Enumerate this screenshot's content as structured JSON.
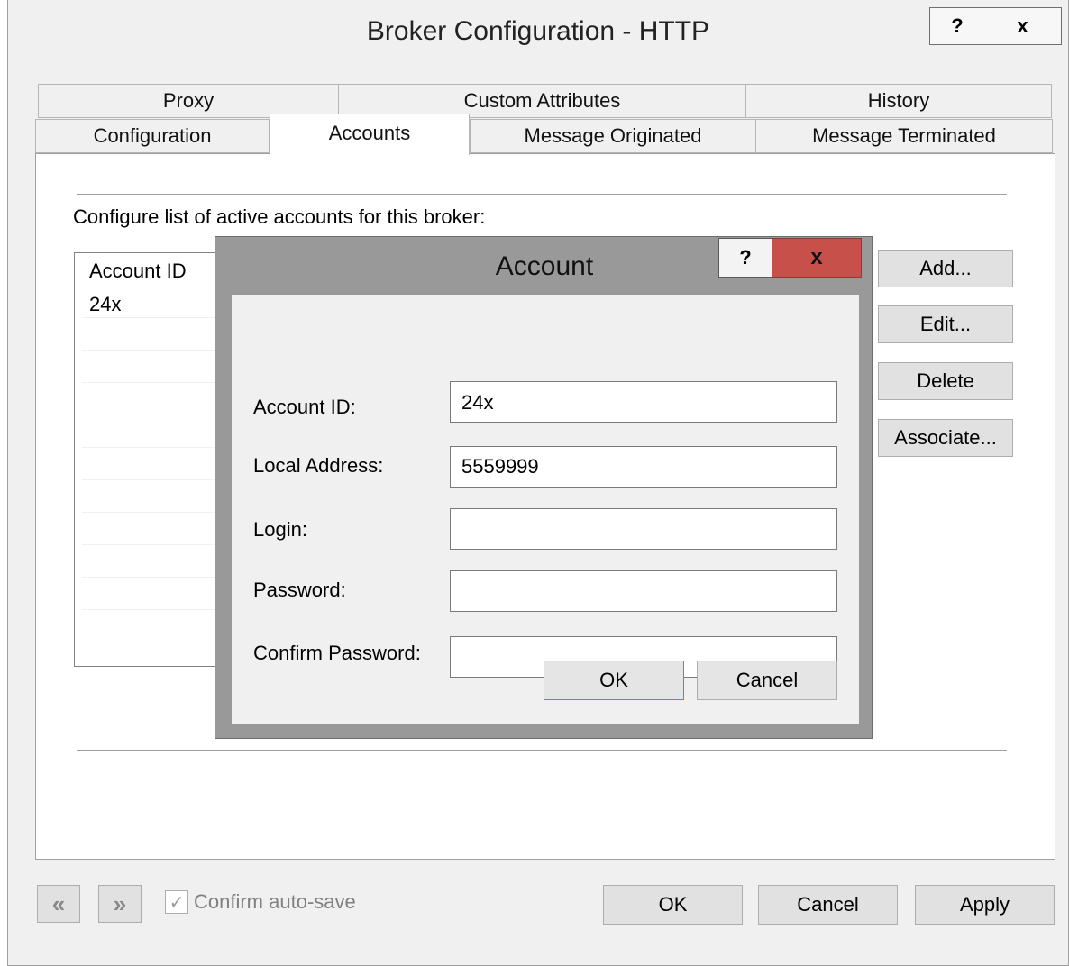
{
  "window": {
    "title": "Broker Configuration - HTTP",
    "help_label": "?",
    "close_label": "x"
  },
  "tabs": {
    "row1": [
      "Proxy",
      "Custom Attributes",
      "History"
    ],
    "row2": [
      "Configuration",
      "Accounts",
      "Message Originated",
      "Message Terminated"
    ],
    "active": "Accounts"
  },
  "accounts": {
    "description": "Configure list of active accounts for this broker:",
    "column_header": "Account ID",
    "rows": [
      "24x"
    ],
    "buttons": {
      "add": "Add...",
      "edit": "Edit...",
      "delete": "Delete",
      "associate": "Associate..."
    }
  },
  "footer": {
    "prev_icon": "«",
    "next_icon": "»",
    "confirm_checked": true,
    "confirm_label": "Confirm auto-save",
    "ok": "OK",
    "cancel": "Cancel",
    "apply": "Apply"
  },
  "dialog": {
    "title": "Account",
    "help_label": "?",
    "close_label": "x",
    "fields": {
      "account_id": {
        "label": "Account ID:",
        "value": "24x"
      },
      "local_address": {
        "label": "Local Address:",
        "value": "5559999"
      },
      "login": {
        "label": "Login:",
        "value": ""
      },
      "password": {
        "label": "Password:",
        "value": ""
      },
      "confirm_password": {
        "label": "Confirm Password:",
        "value": ""
      }
    },
    "ok": "OK",
    "cancel": "Cancel"
  },
  "colors": {
    "dialog_close_bg": "#c7514a",
    "dialog_frame": "#999999",
    "ok_focus_border": "#4a90d9"
  }
}
